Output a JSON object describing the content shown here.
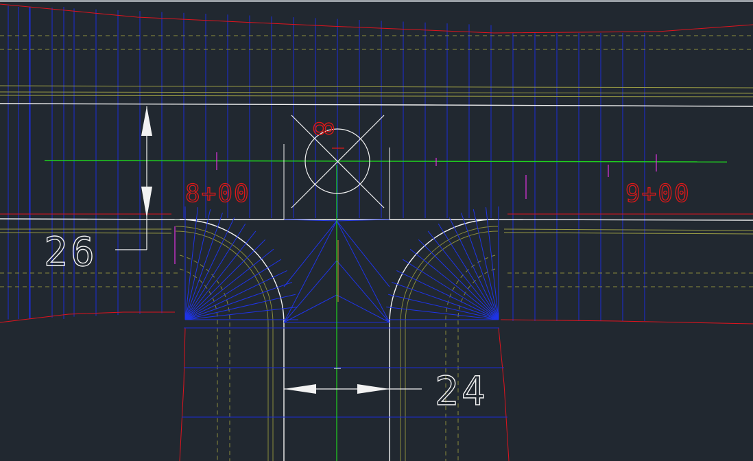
{
  "drawing": {
    "station_labels": [
      "8+00",
      "9+00"
    ],
    "vertical_dimension": "26",
    "horizontal_dimension": "24",
    "circle_annotation": "8"
  },
  "colors": {
    "background": "#212830",
    "edge_red": "#e0141e",
    "grid_blue": "#1a2cd8",
    "fan_blue": "#1f34e8",
    "centerline_green": "#1fd21f",
    "dashed_olive": "#8a8c3c",
    "line_white": "#f2f2f2",
    "text_red": "#e01818",
    "magenta": "#e032e0"
  }
}
